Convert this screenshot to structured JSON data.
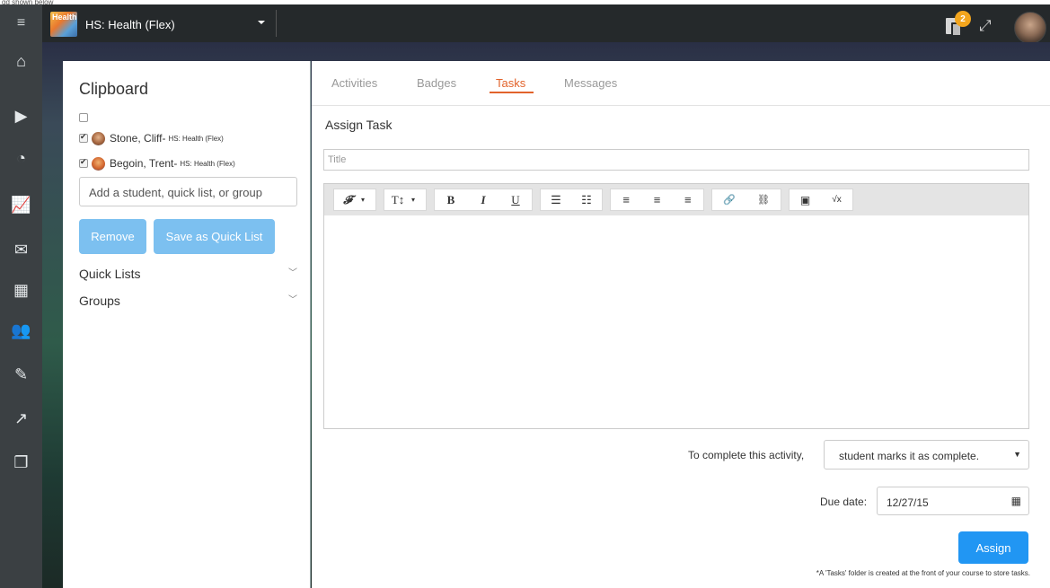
{
  "page_caption": "gd shown below",
  "topbar": {
    "menu_icon": "hamburger-icon",
    "course_name": "HS: Health (Flex)",
    "course_thumb_text": "Health",
    "notification_count": "2"
  },
  "sidebar": {
    "icons": [
      "home-icon",
      "play-icon",
      "dashboard-icon",
      "chart-icon",
      "mail-icon",
      "calendar-icon",
      "users-icon",
      "edit-icon",
      "external-link-icon",
      "documents-icon"
    ]
  },
  "clipboard": {
    "title": "Clipboard",
    "students": [
      {
        "name": "Stone, Cliff",
        "sep": " - ",
        "course": "HS: Health (Flex)",
        "checked": true
      },
      {
        "name": "Begoin, Trent",
        "sep": " - ",
        "course": "HS: Health (Flex)",
        "checked": true
      }
    ],
    "add_placeholder": "Add a student, quick list, or group",
    "remove_label": "Remove",
    "save_label": "Save as Quick List",
    "quick_lists_label": "Quick Lists",
    "groups_label": "Groups"
  },
  "tabs": [
    {
      "label": "Activities",
      "active": false
    },
    {
      "label": "Badges",
      "active": false
    },
    {
      "label": "Tasks",
      "active": true
    },
    {
      "label": "Messages",
      "active": false
    }
  ],
  "task": {
    "heading": "Assign Task",
    "title_placeholder": "Title",
    "toolbar": {
      "font": "𝓕",
      "size": "T↕",
      "bold": "B",
      "italic": "I",
      "underline": "U",
      "bullets": "☰",
      "numbers": "☷",
      "align_left": "≡",
      "align_center": "≡",
      "align_right": "≡",
      "link": "🔗",
      "unlink": "⛓",
      "image": "▣",
      "math": "√x"
    },
    "complete_label": "To complete this activity,",
    "complete_value": "student marks it as complete.",
    "due_label": "Due date:",
    "due_value": "12/27/15",
    "assign_label": "Assign",
    "note": "*A 'Tasks' folder is created at the front of your course to store tasks."
  },
  "colors": {
    "accent": "#e2632b",
    "primary_button": "#2196f3",
    "light_button": "#7cc0f0",
    "badge": "#f3a51d",
    "sidebar": "#3b4043"
  }
}
